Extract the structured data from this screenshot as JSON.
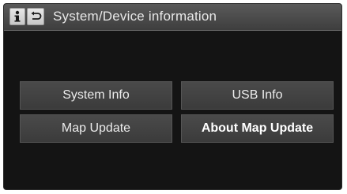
{
  "header": {
    "title": "System/Device information",
    "icons": [
      "info-icon",
      "back-icon"
    ]
  },
  "buttons": {
    "system_info": "System Info",
    "usb_info": "USB Info",
    "map_update": "Map Update",
    "about_map_update": "About Map Update"
  },
  "colors": {
    "screen_background": "#141414",
    "header_background": "#4a4a4a",
    "button_background": "#424242",
    "text": "#ececec"
  }
}
